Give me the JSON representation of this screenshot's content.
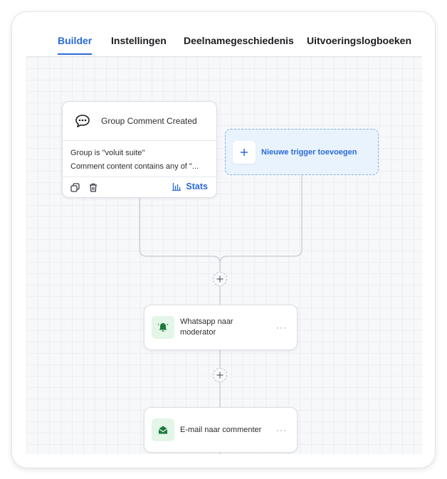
{
  "tabs": [
    {
      "label": "Builder"
    },
    {
      "label": "Instellingen"
    },
    {
      "label": "Deelnamegeschiedenis"
    },
    {
      "label": "Uitvoeringslogboeken"
    }
  ],
  "trigger": {
    "title": "Group Comment Created",
    "icon": "speech-bubble-icon",
    "conditions": [
      "Group is \"voluit suite\"",
      "Comment content contains any of \"..."
    ],
    "stats_label": "Stats"
  },
  "add_trigger": {
    "label": "Nieuwe trigger toevoegen"
  },
  "actions": [
    {
      "label": "Whatsapp naar moderator",
      "icon": "bell-icon"
    },
    {
      "label": "E-mail naar commenter",
      "icon": "envelope-open-icon"
    }
  ],
  "more_label": "···",
  "colors": {
    "accent": "#2a6ad8",
    "action_icon": "#1b7a3c",
    "action_icon_bg": "#e3f6e8",
    "add_trigger_bg": "#e9f3fe"
  }
}
